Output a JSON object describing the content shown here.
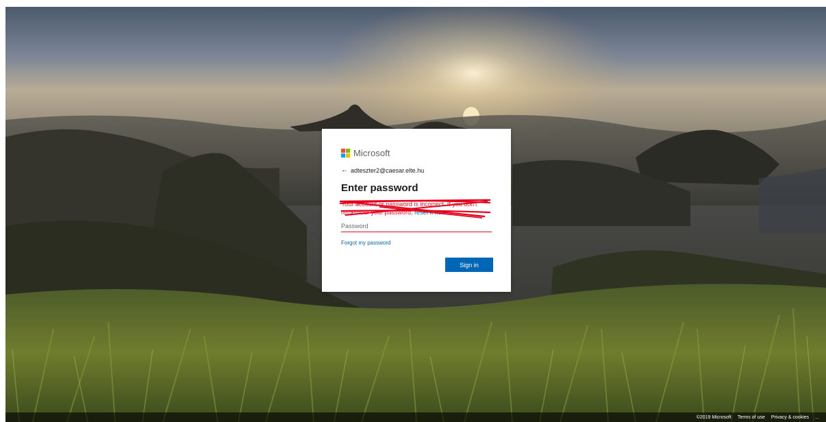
{
  "brand": {
    "name": "Microsoft",
    "logo_colors": [
      "#f25022",
      "#7fba00",
      "#00a4ef",
      "#ffb900"
    ]
  },
  "dialog": {
    "back_icon": "←",
    "identity_email": "adteszter2@caesar.elte.hu",
    "title": "Enter password",
    "error_text": "Your account or password is incorrect. If you don't remember your password,",
    "error_link": "reset it now.",
    "password_placeholder": "Password",
    "forgot_link": "Forgot my password",
    "signin_label": "Sign in"
  },
  "footer": {
    "copyright": "©2019 Microsoft",
    "terms": "Terms of use",
    "privacy": "Privacy & cookies",
    "more": "..."
  },
  "colors": {
    "accent": "#0067b8",
    "error": "#e81123"
  }
}
